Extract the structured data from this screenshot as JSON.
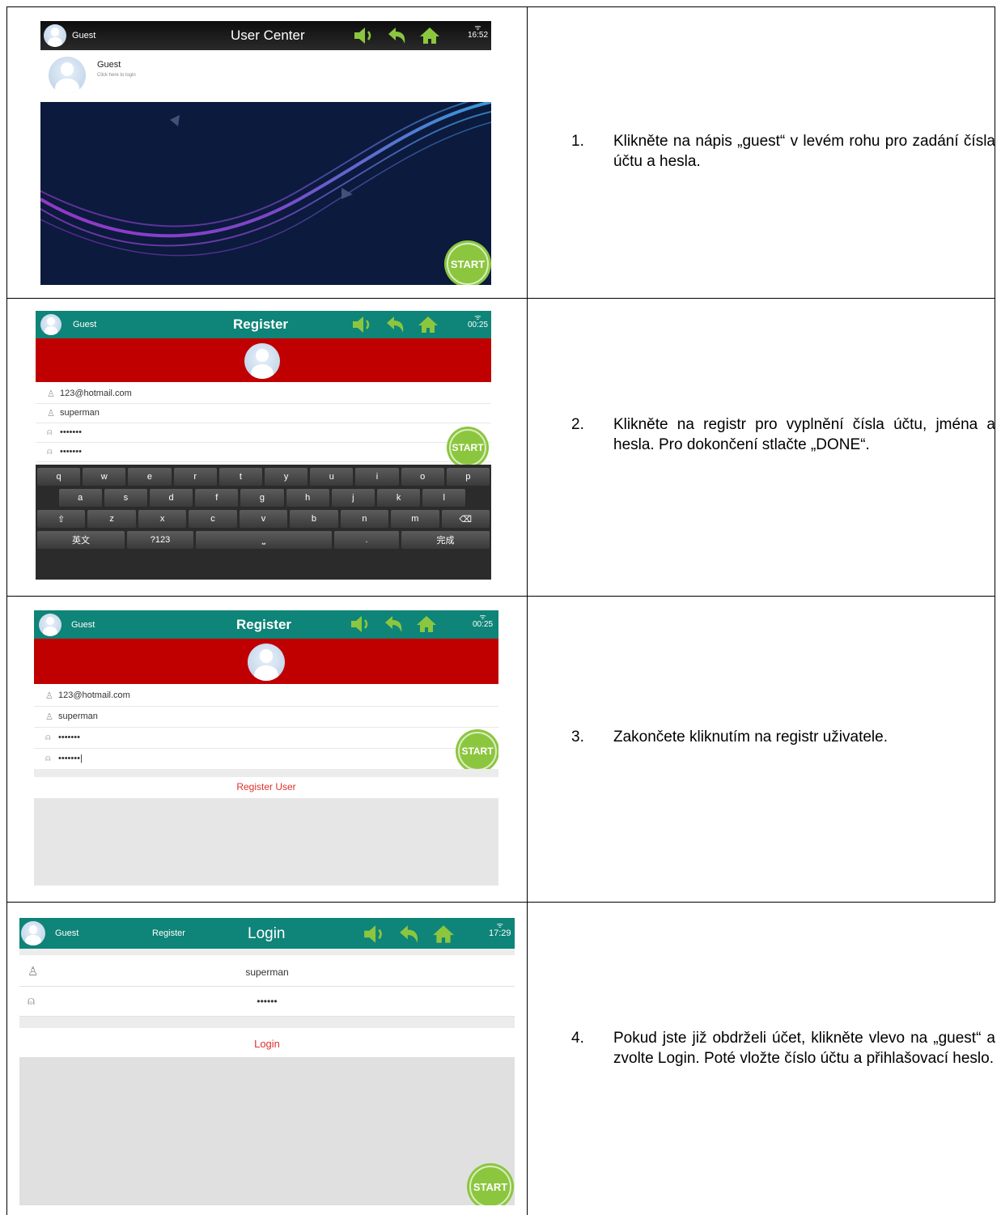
{
  "steps": [
    {
      "num": "1.",
      "text": "Klikněte na nápis „guest“ v levém rohu pro zadání čísla účtu a hesla."
    },
    {
      "num": "2.",
      "text": "Klikněte na registr pro vyplnění čísla účtu, jména a hesla. Pro dokončení stlačte „DONE“."
    },
    {
      "num": "3.",
      "text": "Zakončete kliknutím na registr uživatele."
    },
    {
      "num": "4.",
      "text": "Pokud jste již obdrželi účet, klikněte vlevo na „guest“ a zvolte Login. Poté vložte číslo účtu a přihlašovací heslo."
    }
  ],
  "shot1": {
    "guest": "Guest",
    "title": "User Center",
    "time": "16:52",
    "profile_name": "Guest",
    "profile_hint": "Click here to login",
    "start": "START"
  },
  "shot2": {
    "guest": "Guest",
    "title": "Register",
    "time": "00:25",
    "fields": [
      "123@hotmail.com",
      "superman",
      "•••••••",
      "•••••••"
    ],
    "start": "START",
    "keys_row1": [
      "q",
      "w",
      "e",
      "r",
      "t",
      "y",
      "u",
      "i",
      "o",
      "p"
    ],
    "keys_row2": [
      "a",
      "s",
      "d",
      "f",
      "g",
      "h",
      "j",
      "k",
      "l"
    ],
    "keys_row3": [
      "⇧",
      "z",
      "x",
      "c",
      "v",
      "b",
      "n",
      "m",
      "⌫"
    ],
    "key_lang": "英文",
    "key_num": "?123",
    "key_space": "⎵",
    "key_dot": ".",
    "key_done": "完成"
  },
  "shot3": {
    "guest": "Guest",
    "title": "Register",
    "time": "00:25",
    "fields": [
      "123@hotmail.com",
      "superman",
      "•••••••",
      "•••••••|"
    ],
    "start": "START",
    "register_user": "Register User"
  },
  "shot4": {
    "guest": "Guest",
    "register": "Register",
    "title": "Login",
    "time": "17:29",
    "username": "superman",
    "password": "••••••",
    "login": "Login",
    "start": "START"
  },
  "colors": {
    "teal": "#0f8478",
    "red": "#c00000",
    "start_green": "#8cc63f",
    "icon_green": "#8cc63f"
  }
}
